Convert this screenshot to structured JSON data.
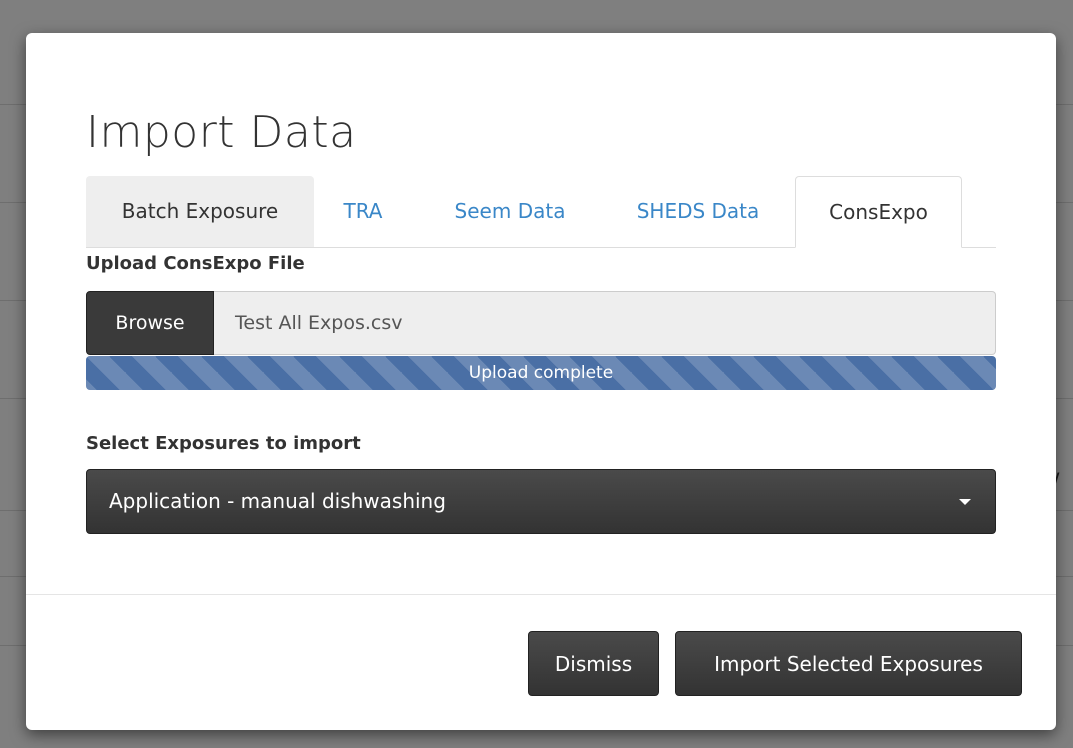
{
  "modal": {
    "title": "Import Data",
    "tabs": [
      {
        "label": "Batch Exposure",
        "active": false
      },
      {
        "label": "TRA",
        "active": false
      },
      {
        "label": "Seem Data",
        "active": false
      },
      {
        "label": "SHEDS Data",
        "active": false
      },
      {
        "label": "ConsExpo",
        "active": true
      }
    ],
    "upload": {
      "label": "Upload ConsExpo File",
      "browse_label": "Browse",
      "file_name": "Test All Expos.csv",
      "progress_text": "Upload complete",
      "progress": 1.0
    },
    "select": {
      "label": "Select Exposures to import",
      "value": "Application - manual dishwashing"
    },
    "footer": {
      "dismiss_label": "Dismiss",
      "import_label": "Import Selected Exposures"
    }
  },
  "colors": {
    "tab_link": "#3a87c8",
    "progress_bar": "#4a6fa5",
    "dark_button": "#333333"
  }
}
